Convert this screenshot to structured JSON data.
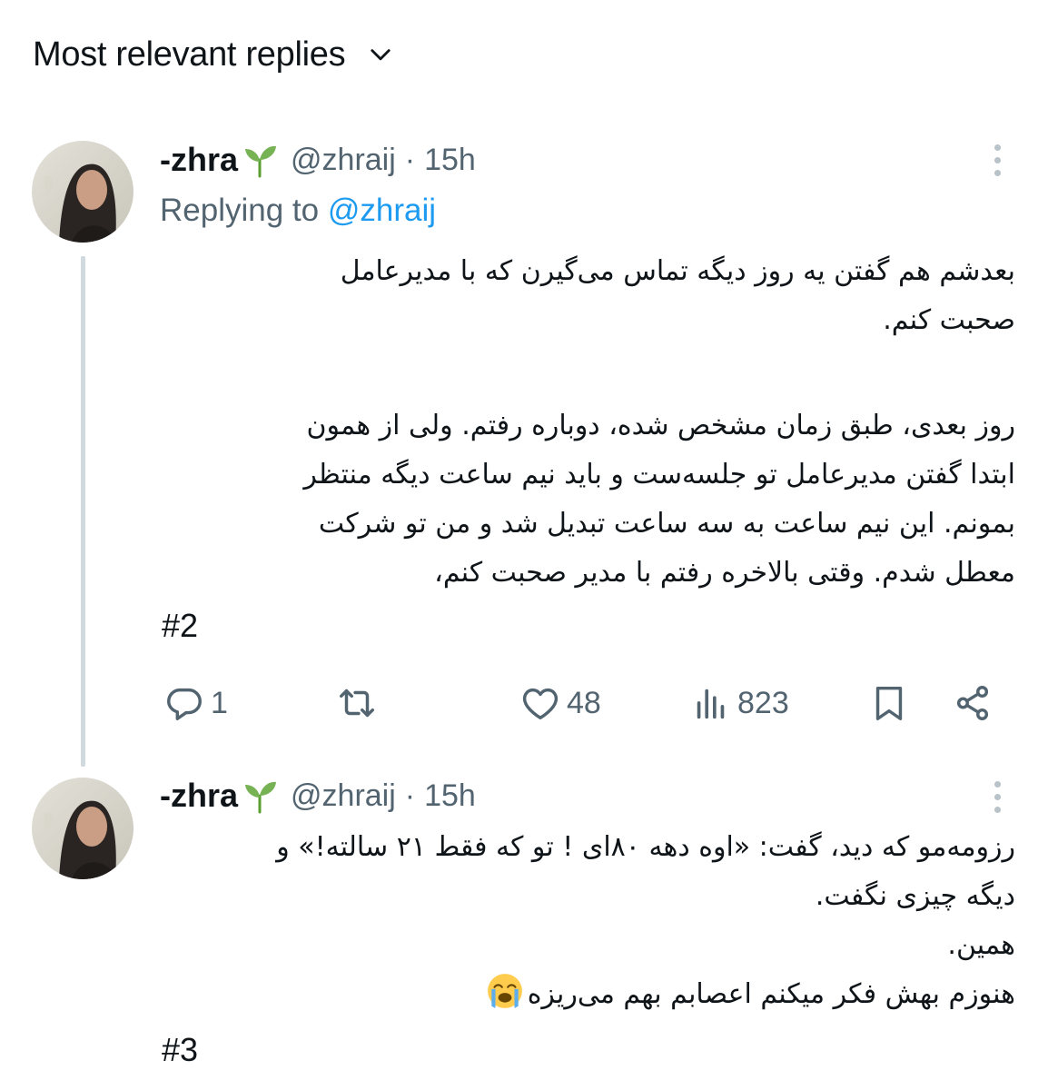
{
  "header": {
    "title": "Most relevant replies",
    "chevron_icon": "chevron-down-icon"
  },
  "tweets": [
    {
      "name": "-zhra",
      "name_emoji": "seedling-icon",
      "handle": "@zhraij",
      "separator": "·",
      "time": "15h",
      "replying_prefix": "Replying to",
      "replying_handle": "@zhraij",
      "paragraph1": [
        "بعدشم هم گفتن یه روز دیگه تماس می‌گیرن که با مدیرعامل",
        "صحبت کنم."
      ],
      "paragraph2": [
        "روز بعدی، طبق زمان مشخص شده، دوباره رفتم. ولی از همون",
        "ابتدا گفتن مدیرعامل تو جلسه‌ست و باید نیم ساعت دیگه منتظر",
        "بمونم. این نیم ساعت به سه ساعت تبدیل شد و من تو شرکت",
        "معطل شدم. وقتی بالاخره رفتم با مدیر صحبت کنم،"
      ],
      "hashtag": "#2",
      "actions": {
        "reply_count": "1",
        "retweet_count": "",
        "like_count": "48",
        "view_count": "823"
      }
    },
    {
      "name": "-zhra",
      "name_emoji": "seedling-icon",
      "handle": "@zhraij",
      "separator": "·",
      "time": "15h",
      "lines": [
        "رزومه‌مو که دید، گفت: «اوه دهه ۸۰ای ! تو که فقط ۲۱ سالته!» و",
        "دیگه چیزی نگفت.",
        "همین.",
        "هنوزم بهش فکر میکنم اعصابم بهم می‌ریزه"
      ],
      "last_line_emoji": "loudly-crying-face-icon",
      "hashtag": "#3"
    }
  ],
  "colors": {
    "text": "#0f1419",
    "secondary": "#536471",
    "link": "#1d9bf0",
    "thread_line": "#cfd9de"
  }
}
